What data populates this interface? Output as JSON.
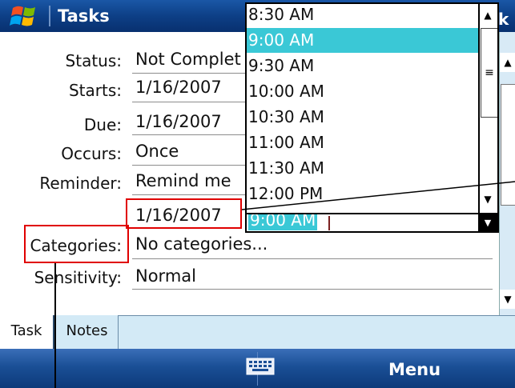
{
  "title_bar": {
    "app_title": "Tasks",
    "ok_fragment": "k"
  },
  "form": {
    "status": {
      "label": "Status:",
      "value": "Not Complet"
    },
    "starts": {
      "label": "Starts:",
      "value": "1/16/2007"
    },
    "due": {
      "label": "Due:",
      "value": "1/16/2007"
    },
    "occurs": {
      "label": "Occurs:",
      "value": "Once"
    },
    "reminder": {
      "label": "Reminder:",
      "value": "Remind me",
      "date": "1/16/2007"
    },
    "categories": {
      "label": "Categories:",
      "value": "No categories..."
    },
    "sensitivity": {
      "label": "Sensitivity:",
      "value": "Normal"
    }
  },
  "time_dropdown": {
    "items": [
      "8:30 AM",
      "9:00 AM",
      "9:30 AM",
      "10:00 AM",
      "10:30 AM",
      "11:00 AM",
      "11:30 AM",
      "12:00 PM"
    ],
    "selected": "9:00 AM",
    "field_value": "9:00 AM"
  },
  "tabs": [
    "Task",
    "Notes"
  ],
  "softkeys": {
    "right": "Menu"
  },
  "icons": {
    "logo": "windows-logo-icon",
    "keyboard": "keyboard-icon",
    "scroll_up": "scroll-up-arrow-icon",
    "scroll_down": "scroll-down-arrow-icon",
    "dropdown": "dropdown-arrow-icon"
  },
  "colors": {
    "title_bar": "#0d3f86",
    "selection": "#3ac8d6",
    "annotation": "#e00000",
    "tab_bar": "#d3eaf6"
  }
}
